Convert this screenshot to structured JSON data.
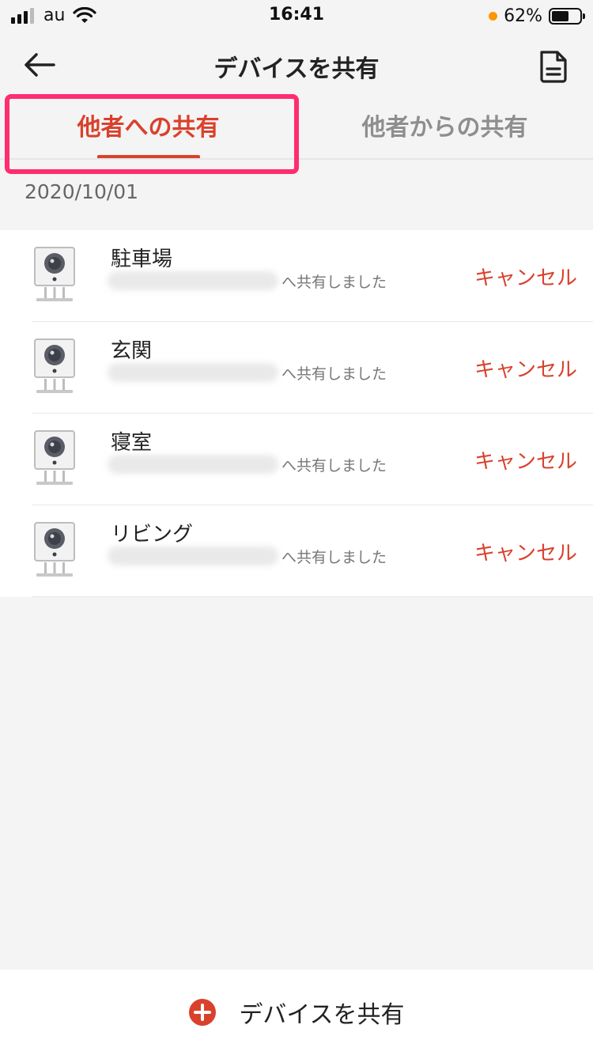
{
  "status_bar": {
    "carrier": "au",
    "time": "16:41",
    "battery_percent": "62%",
    "battery_level": 0.62,
    "signal_bars": 3,
    "signal_total": 4
  },
  "header": {
    "title": "デバイスを共有",
    "back_icon": "arrow-left-icon",
    "doc_icon": "document-icon"
  },
  "tabs": [
    {
      "label": "他者への共有",
      "active": true
    },
    {
      "label": "他者からの共有",
      "active": false
    }
  ],
  "section": {
    "date": "2020/10/01"
  },
  "devices": [
    {
      "name": "駐車場",
      "share_text": "へ共有しました",
      "cancel_label": "キャンセル",
      "icon": "camera-icon"
    },
    {
      "name": "玄関",
      "share_text": "へ共有しました",
      "cancel_label": "キャンセル",
      "icon": "camera-icon"
    },
    {
      "name": "寝室",
      "share_text": "へ共有しました",
      "cancel_label": "キャンセル",
      "icon": "camera-icon"
    },
    {
      "name": "リビング",
      "share_text": "へ共有しました",
      "cancel_label": "キャンセル",
      "icon": "camera-icon"
    }
  ],
  "bottom": {
    "label": "デバイスを共有",
    "icon": "plus-circle-icon"
  },
  "colors": {
    "accent": "#d9412c",
    "highlight": "#ff2d6f",
    "background": "#f4f4f4"
  }
}
